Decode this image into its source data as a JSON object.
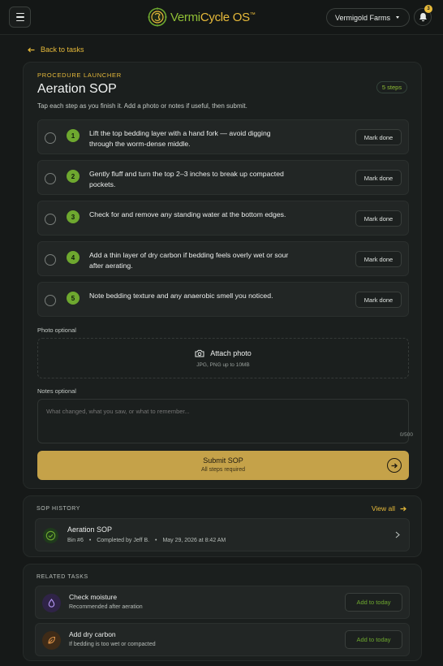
{
  "header": {
    "brand_primary": "Vermi",
    "brand_secondary": "Cycle OS",
    "brand_tm": "™",
    "farm": "Vermigold Farms",
    "notification_count": "3"
  },
  "nav": {
    "back_label": "Back to tasks"
  },
  "launcher": {
    "eyebrow": "Procedure Launcher",
    "title": "Aeration SOP",
    "steps_count": "5 steps",
    "subtitle": "Tap each step as you finish it. Add a photo or notes if useful, then submit.",
    "steps": [
      {
        "num": "1",
        "text": "Lift the top bedding layer with a hand fork — avoid digging through the worm-dense middle.",
        "action": "Mark done"
      },
      {
        "num": "2",
        "text": "Gently fluff and turn the top 2–3 inches to break up compacted pockets.",
        "action": "Mark done"
      },
      {
        "num": "3",
        "text": "Check for and remove any standing water at the bottom edges.",
        "action": "Mark done"
      },
      {
        "num": "4",
        "text": "Add a thin layer of dry carbon if bedding feels overly wet or sour after aerating.",
        "action": "Mark done"
      },
      {
        "num": "5",
        "text": "Note bedding texture and any anaerobic smell you noticed.",
        "action": "Mark done"
      }
    ],
    "photo_label": "Photo optional",
    "photo_button": "Attach photo",
    "photo_hint": "JPG, PNG up to 10MB",
    "notes_label": "Notes optional",
    "notes_placeholder": "What changed, what you saw, or what to remember...",
    "notes_counter": "0/500",
    "submit_label": "Submit SOP",
    "submit_sub": "All steps required"
  },
  "history": {
    "eyebrow": "SOP History",
    "view_all": "View all",
    "items": [
      {
        "title": "Aeration SOP",
        "bin": "Bin #6",
        "completed": "Completed by Jeff B.",
        "date": "May 29, 2026 at 8:42 AM"
      }
    ]
  },
  "related": {
    "eyebrow": "Related Tasks",
    "items": [
      {
        "title": "Check moisture",
        "sub": "Recommended after aeration",
        "action": "Add to today",
        "icon": "droplet-icon",
        "color": "#a78bfa"
      },
      {
        "title": "Add dry carbon",
        "sub": "If bedding is too wet or compacted",
        "action": "Add to today",
        "icon": "leaf-icon",
        "color": "#d9893a"
      }
    ]
  },
  "colors": {
    "accent": "#e7ba3a",
    "success": "#6ea82f",
    "submit_bg": "#c5a249"
  }
}
